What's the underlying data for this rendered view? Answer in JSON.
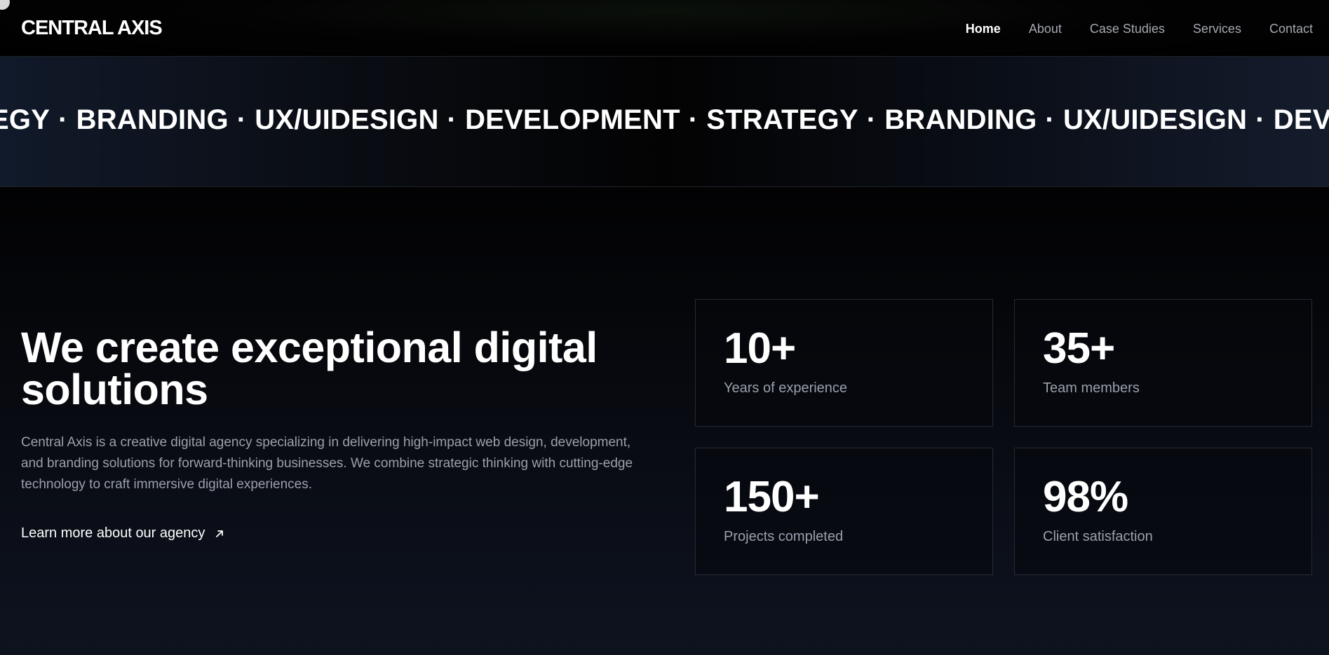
{
  "header": {
    "logo": "CENTRAL AXIS",
    "nav": [
      {
        "label": "Home",
        "active": true
      },
      {
        "label": "About",
        "active": false
      },
      {
        "label": "Case Studies",
        "active": false
      },
      {
        "label": "Services",
        "active": false
      },
      {
        "label": "Contact",
        "active": false
      }
    ]
  },
  "marquee": {
    "items": [
      "EGY",
      "BRANDING",
      "UX/UIDESIGN",
      "DEVELOPMENT",
      "STRATEGY",
      "BRANDING",
      "UX/UIDESIGN",
      "DEVELOPMENT"
    ],
    "separator": "·"
  },
  "hero": {
    "heading": "We create exceptional digital solutions",
    "description": "Central Axis is a creative digital agency specializing in delivering high-impact web design, development, and branding solutions for forward-thinking businesses. We combine strategic thinking with cutting-edge technology to craft immersive digital experiences.",
    "link_label": "Learn more about our agency",
    "link_icon": "arrow-up-right-icon"
  },
  "stats": [
    {
      "value": "10+",
      "label": "Years of experience"
    },
    {
      "value": "35+",
      "label": "Team members"
    },
    {
      "value": "150+",
      "label": "Projects completed"
    },
    {
      "value": "98%",
      "label": "Client satisfaction"
    }
  ],
  "colors": {
    "background": "#000000",
    "text_primary": "#ffffff",
    "text_muted": "#9aa0aa",
    "card_border": "#262a32"
  }
}
